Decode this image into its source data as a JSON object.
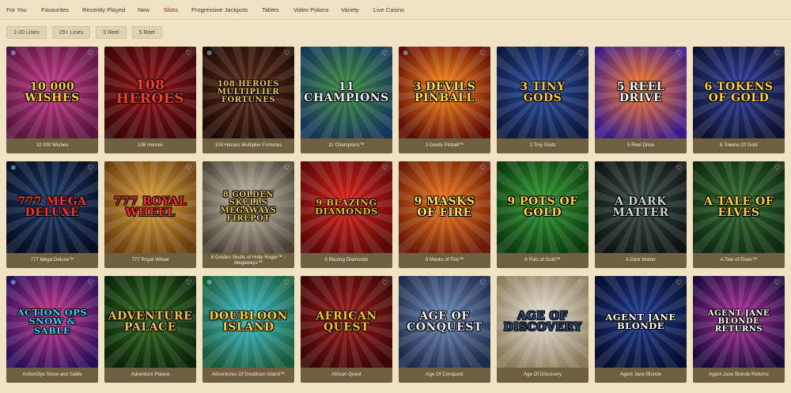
{
  "nav": {
    "tabs": [
      {
        "label": "For You",
        "active": false
      },
      {
        "label": "Favourites",
        "active": false
      },
      {
        "label": "Recently Played",
        "active": false
      },
      {
        "label": "New",
        "active": false
      },
      {
        "label": "Slots",
        "active": true
      },
      {
        "label": "Progressive Jackpots",
        "active": false
      },
      {
        "label": "Tables",
        "active": false
      },
      {
        "label": "Video Pokers",
        "active": false
      },
      {
        "label": "Variety",
        "active": false
      },
      {
        "label": "Live Casino",
        "active": false
      }
    ]
  },
  "filters": [
    "1-20 Lines",
    "25+ Lines",
    "3 Reel",
    "5 Reel"
  ],
  "icons": {
    "favourite": "heart-outline-icon",
    "snow": "snowflake-icon"
  },
  "games": [
    {
      "title": "10 000 Wishes",
      "logo": "10 000 WISHES",
      "bg1": "#c23a86",
      "bg2": "#5a1340",
      "fg": "#ffd23a",
      "snow": true
    },
    {
      "title": "108 Heroes",
      "logo": "108 HEROES",
      "bg1": "#8e1416",
      "bg2": "#3d0608",
      "fg": "#ff3b2a",
      "snow": false
    },
    {
      "title": "108 Heroes Multiplier Fortunes",
      "logo": "108 HEROES MULTIPLIER FORTUNES",
      "bg1": "#5a2a16",
      "bg2": "#1e0b05",
      "fg": "#f0c24a",
      "snow": true
    },
    {
      "title": "11 Champions™",
      "logo": "11 CHAMPIONS",
      "bg1": "#3a8a3a",
      "bg2": "#14355c",
      "fg": "#e8f2ff",
      "snow": false
    },
    {
      "title": "3 Devils Pinball™",
      "logo": "3 DEVILS PINBALL",
      "bg1": "#ff8c1a",
      "bg2": "#5e0c05",
      "fg": "#ffe04a",
      "snow": true
    },
    {
      "title": "3 Tiny Gods",
      "logo": "3 TINY GODS",
      "bg1": "#2a4c9c",
      "bg2": "#0c1840",
      "fg": "#f5c84a",
      "snow": false
    },
    {
      "title": "5 Reel Drive",
      "logo": "5 REEL DRIVE",
      "bg1": "#ff7a1e",
      "bg2": "#3a1a8a",
      "fg": "#ffffff",
      "snow": false
    },
    {
      "title": "6 Tokens Of Gold",
      "logo": "6 TOKENS OF GOLD",
      "bg1": "#2c3c9a",
      "bg2": "#0e1230",
      "fg": "#ffd23a",
      "snow": false
    },
    {
      "title": "777 Mega Deluxe™",
      "logo": "777 MEGA DELUXE",
      "bg1": "#1c3a6a",
      "bg2": "#060e22",
      "fg": "#ff3030",
      "snow": true
    },
    {
      "title": "777 Royal Wheel",
      "logo": "777 ROYAL WHEEL",
      "bg1": "#d9a23a",
      "bg2": "#6a3e0e",
      "fg": "#ff2a20",
      "snow": false
    },
    {
      "title": "8 Golden Skulls of Holly Roger™ - Megaways™",
      "logo": "8 GOLDEN SKULLS MEGAWAYS FIREPOT",
      "bg1": "#c9c2b2",
      "bg2": "#4a4234",
      "fg": "#f2c64a",
      "snow": false
    },
    {
      "title": "9 Blazing Diamonds",
      "logo": "9 BLAZING DIAMONDS",
      "bg1": "#d9221a",
      "bg2": "#5a0808",
      "fg": "#ffb21a",
      "snow": false
    },
    {
      "title": "9 Masks of Fire™",
      "logo": "9 MASKS OF FIRE",
      "bg1": "#f07a1a",
      "bg2": "#6a1a06",
      "fg": "#ffe04a",
      "snow": false
    },
    {
      "title": "9 Pots of Gold™",
      "logo": "9 POTS OF GOLD",
      "bg1": "#2e9a2e",
      "bg2": "#0a3a0e",
      "fg": "#ffd23a",
      "snow": false
    },
    {
      "title": "A Dark Matter",
      "logo": "A DARK MATTER",
      "bg1": "#3a4a44",
      "bg2": "#0c1412",
      "fg": "#c8d4cc",
      "snow": false
    },
    {
      "title": "A Tale of Elves™",
      "logo": "A TALE OF ELVES",
      "bg1": "#2e6a2a",
      "bg2": "#0e2a10",
      "fg": "#ffd23a",
      "snow": false
    },
    {
      "title": "ActionOps Snow and Sable",
      "logo": "ACTION OPS SNOW & SABLE",
      "bg1": "#c8388a",
      "bg2": "#2a0e5a",
      "fg": "#3ad0ff",
      "snow": true
    },
    {
      "title": "Adventure Palace",
      "logo": "ADVENTURE PALACE",
      "bg1": "#2e6a1e",
      "bg2": "#0a2408",
      "fg": "#f2c24a",
      "snow": false
    },
    {
      "title": "Adventures Of Doubloon Island™",
      "logo": "DOUBLOON ISLAND",
      "bg1": "#3ac0d0",
      "bg2": "#1a5a3a",
      "fg": "#ffd23a",
      "snow": true
    },
    {
      "title": "African Quest",
      "logo": "AFRICAN QUEST",
      "bg1": "#a01a1a",
      "bg2": "#3a0606",
      "fg": "#ffc21a",
      "snow": false
    },
    {
      "title": "Age Of Conquest",
      "logo": "AGE OF CONQUEST",
      "bg1": "#6a8ab8",
      "bg2": "#1e2a4a",
      "fg": "#e8eef8",
      "snow": false
    },
    {
      "title": "Age Of Discovery",
      "logo": "AGE OF DISCOVERY",
      "bg1": "#e8e4d8",
      "bg2": "#8a7a5a",
      "fg": "#2a4a7a",
      "snow": false
    },
    {
      "title": "Agent Jane Blonde",
      "logo": "AGENT JANE BLONDE",
      "bg1": "#1e3a8a",
      "bg2": "#060e30",
      "fg": "#ffffff",
      "snow": false
    },
    {
      "title": "Agent Jane Blonde Returns",
      "logo": "AGENT JANE BLONDE RETURNS",
      "bg1": "#b0309a",
      "bg2": "#1a0a3a",
      "fg": "#ffffff",
      "snow": false
    }
  ]
}
